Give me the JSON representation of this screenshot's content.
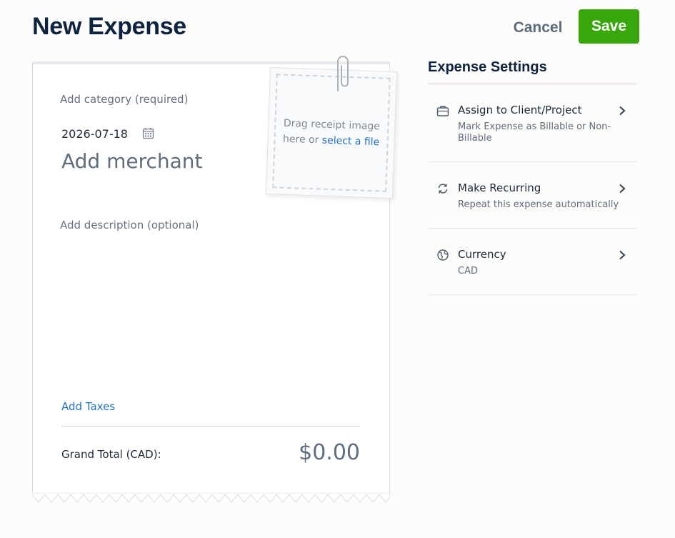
{
  "header": {
    "title": "New Expense",
    "cancel_label": "Cancel",
    "save_label": "Save"
  },
  "receipt": {
    "category_placeholder": "Add category (required)",
    "date": "2026-07-18",
    "merchant_placeholder": "Add merchant",
    "description_placeholder": "Add description (optional)",
    "add_taxes_label": "Add Taxes",
    "grand_total_label": "Grand Total (CAD):",
    "grand_total_value": "$0.00"
  },
  "upload": {
    "line1": "Drag receipt image",
    "line2_prefix": "here or ",
    "link_label": "select a file"
  },
  "settings": {
    "title": "Expense Settings",
    "items": [
      {
        "title": "Assign to Client/Project",
        "subtitle": "Mark Expense as Billable or Non-Billable",
        "icon": "briefcase-icon"
      },
      {
        "title": "Make Recurring",
        "subtitle": "Repeat this expense automatically",
        "icon": "refresh-icon"
      },
      {
        "title": "Currency",
        "subtitle": "CAD",
        "icon": "globe-icon"
      }
    ]
  },
  "colors": {
    "save": "#37a70c",
    "link": "#2471c8",
    "title": "#0d2340"
  }
}
